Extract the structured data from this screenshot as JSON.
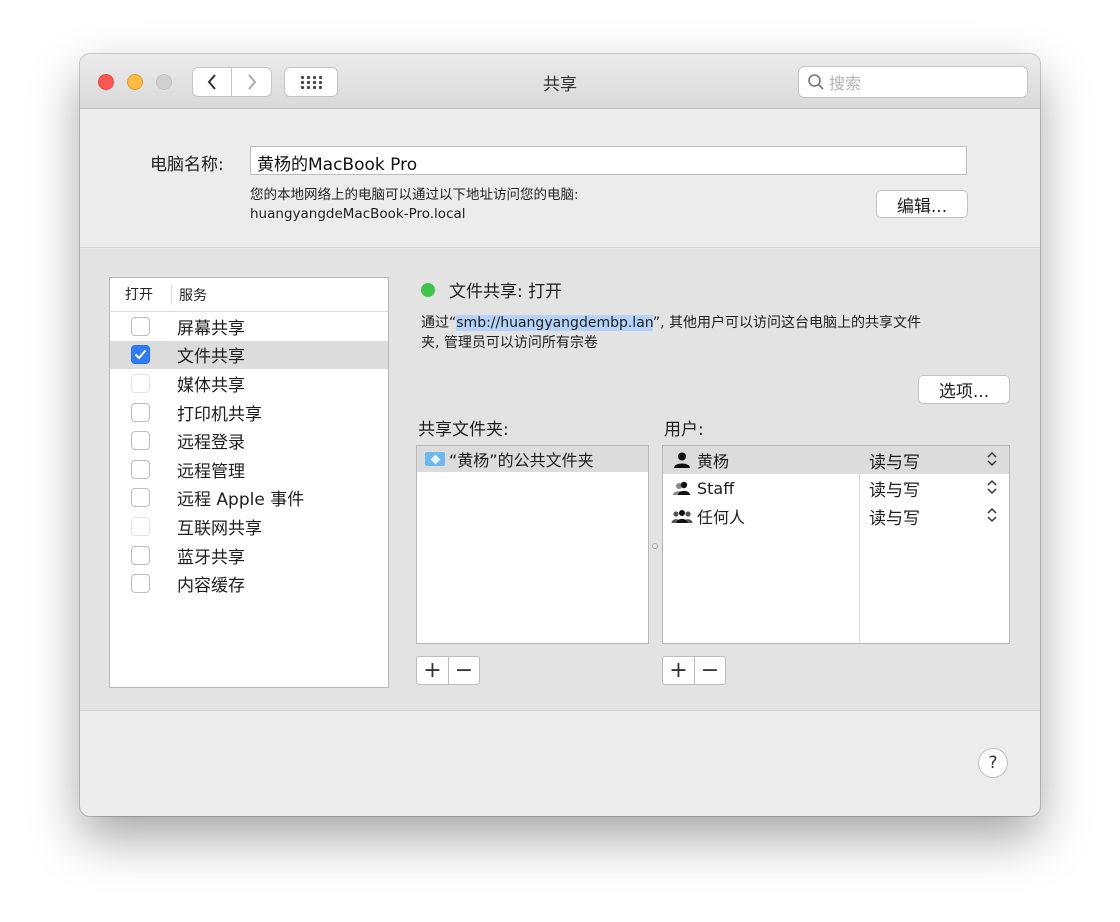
{
  "window": {
    "title": "共享",
    "search_placeholder": "搜索"
  },
  "computer_name": {
    "label": "电脑名称:",
    "value": "黄杨的MacBook Pro",
    "address_line1": "您的本地网络上的电脑可以通过以下地址访问您的电脑:",
    "address_line2": "huangyangdeMacBook-Pro.local",
    "edit_label": "编辑..."
  },
  "services": {
    "header_open": "打开",
    "header_service": "服务",
    "items": [
      {
        "label": "屏幕共享",
        "checked": false,
        "enabled": true
      },
      {
        "label": "文件共享",
        "checked": true,
        "enabled": true
      },
      {
        "label": "媒体共享",
        "checked": false,
        "enabled": false
      },
      {
        "label": "打印机共享",
        "checked": false,
        "enabled": true
      },
      {
        "label": "远程登录",
        "checked": false,
        "enabled": true
      },
      {
        "label": "远程管理",
        "checked": false,
        "enabled": true
      },
      {
        "label": "远程 Apple 事件",
        "checked": false,
        "enabled": true
      },
      {
        "label": "互联网共享",
        "checked": false,
        "enabled": false
      },
      {
        "label": "蓝牙共享",
        "checked": false,
        "enabled": true
      },
      {
        "label": "内容缓存",
        "checked": false,
        "enabled": true
      }
    ]
  },
  "detail": {
    "status": "文件共享: 打开",
    "status_color": "#3ec64a",
    "desc_prefix": "通过“",
    "desc_url": "smb://huangyangdembp.lan",
    "desc_suffix": "”, 其他用户可以访问这台电脑上的共享文件",
    "desc_line2": "夹, 管理员可以访问所有宗卷",
    "options_label": "选项...",
    "folders_label": "共享文件夹:",
    "users_label": "用户:",
    "folders": [
      {
        "name": "“黄杨”的公共文件夹"
      }
    ],
    "users": [
      {
        "name": "黄杨",
        "icon": "single-user-icon",
        "permission": "读与写"
      },
      {
        "name": "Staff",
        "icon": "group-icon",
        "permission": "读与写"
      },
      {
        "name": "任何人",
        "icon": "everyone-icon",
        "permission": "读与写"
      }
    ],
    "add_symbol": "+",
    "remove_symbol": "−"
  },
  "help_symbol": "?",
  "accent_color": "#2f7cf6"
}
